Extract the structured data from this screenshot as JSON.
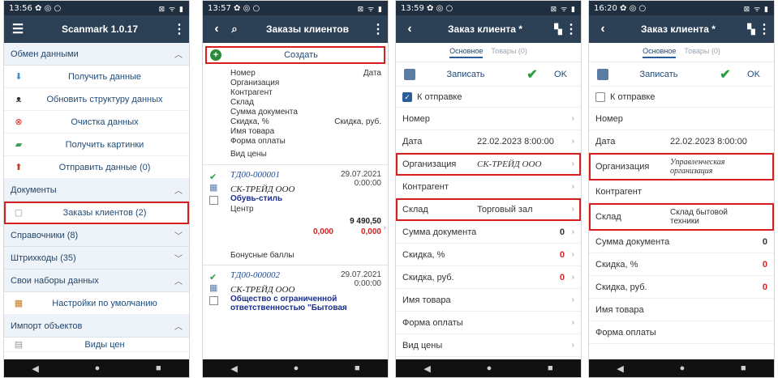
{
  "screen1": {
    "status_time": "13:56",
    "status_icons": "✿ ◎ ○",
    "status_right": "⊠ ᯤ ▮",
    "app_title": "Scanmark 1.0.17",
    "sections": [
      {
        "title": "Обмен данными",
        "items": [
          "Получить данные",
          "Обновить структуру данных",
          "Очистка данных",
          "Получить картинки",
          "Отправить данные (0)"
        ]
      },
      {
        "title": "Документы",
        "items": [
          "Заказы клиентов (2)"
        ]
      },
      {
        "title": "Справочники (8)"
      },
      {
        "title": "Штрихкоды (35)"
      },
      {
        "title": "Свои наборы данных",
        "items": [
          "Настройки по умолчанию"
        ]
      },
      {
        "title": "Импорт объектов",
        "items": [
          "Виды цен"
        ]
      }
    ]
  },
  "screen2": {
    "status_time": "13:57",
    "title": "Заказы клиентов",
    "create_label": "Создать",
    "header_left": [
      "Номер",
      "Организация",
      "Контрагент",
      "Склад",
      "Сумма документа",
      "Скидка, %",
      "Имя товара",
      "Форма оплаты",
      "Вид цены"
    ],
    "header_right_date": "Дата",
    "header_right_disc": "Скидка, руб.",
    "orders": [
      {
        "num": "ТД00-000001",
        "date1": "29.07.2021",
        "date2": "0:00:00",
        "org": "СК-ТРЕЙД ООО",
        "client": "Обувь-стиль",
        "store": "Центр",
        "sum": "9 490,50",
        "disc_pct": "0,000",
        "disc_rub": "0,000",
        "bonus": "Бонусные баллы"
      },
      {
        "num": "ТД00-000002",
        "date1": "29.07.2021",
        "date2": "0:00:00",
        "org": "СК-ТРЕЙД ООО",
        "client": "Общество с ограниченной ответственностью \"Бытовая"
      }
    ]
  },
  "screen3": {
    "status_time": "13:59",
    "title": "Заказ клиента *",
    "tab_main": "Основное",
    "tab_goods": "Товары (0)",
    "save_label": "Записать",
    "ok_label": "OK",
    "send_label": "К отправке",
    "fields": {
      "number": "Номер",
      "date_label": "Дата",
      "date_value": "22.02.2023 8:00:00",
      "org_label": "Организация",
      "org_value": "СК-ТРЕЙД ООО",
      "contr_label": "Контрагент",
      "store_label": "Склад",
      "store_value": "Торговый зал",
      "sum_label": "Сумма документа",
      "sum_value": "0",
      "dpct_label": "Скидка, %",
      "dpct_value": "0",
      "drub_label": "Скидка, руб.",
      "drub_value": "0",
      "goods_label": "Имя товара",
      "pay_label": "Форма оплаты",
      "price_label": "Вид цены"
    }
  },
  "screen4": {
    "status_time": "16:20",
    "title": "Заказ клиента *",
    "tab_main": "Основное",
    "tab_goods": "Товары (0)",
    "save_label": "Записать",
    "ok_label": "OK",
    "send_label": "К отправке",
    "fields": {
      "number": "Номер",
      "date_label": "Дата",
      "date_value": "22.02.2023 8:00:00",
      "org_label": "Организация",
      "org_value_1": "Управленческая",
      "org_value_2": "организация",
      "contr_label": "Контрагент",
      "store_label": "Склад",
      "store_value_1": "Склад бытовой",
      "store_value_2": "техники",
      "sum_label": "Сумма документа",
      "sum_value": "0",
      "dpct_label": "Скидка, %",
      "dpct_value": "0",
      "drub_label": "Скидка, руб.",
      "drub_value": "0",
      "goods_label": "Имя товара",
      "pay_label": "Форма оплаты"
    }
  },
  "colors": {
    "highlight": "#d81e1e",
    "appbar": "#2b3f55",
    "accent_green": "#2b9b40"
  }
}
